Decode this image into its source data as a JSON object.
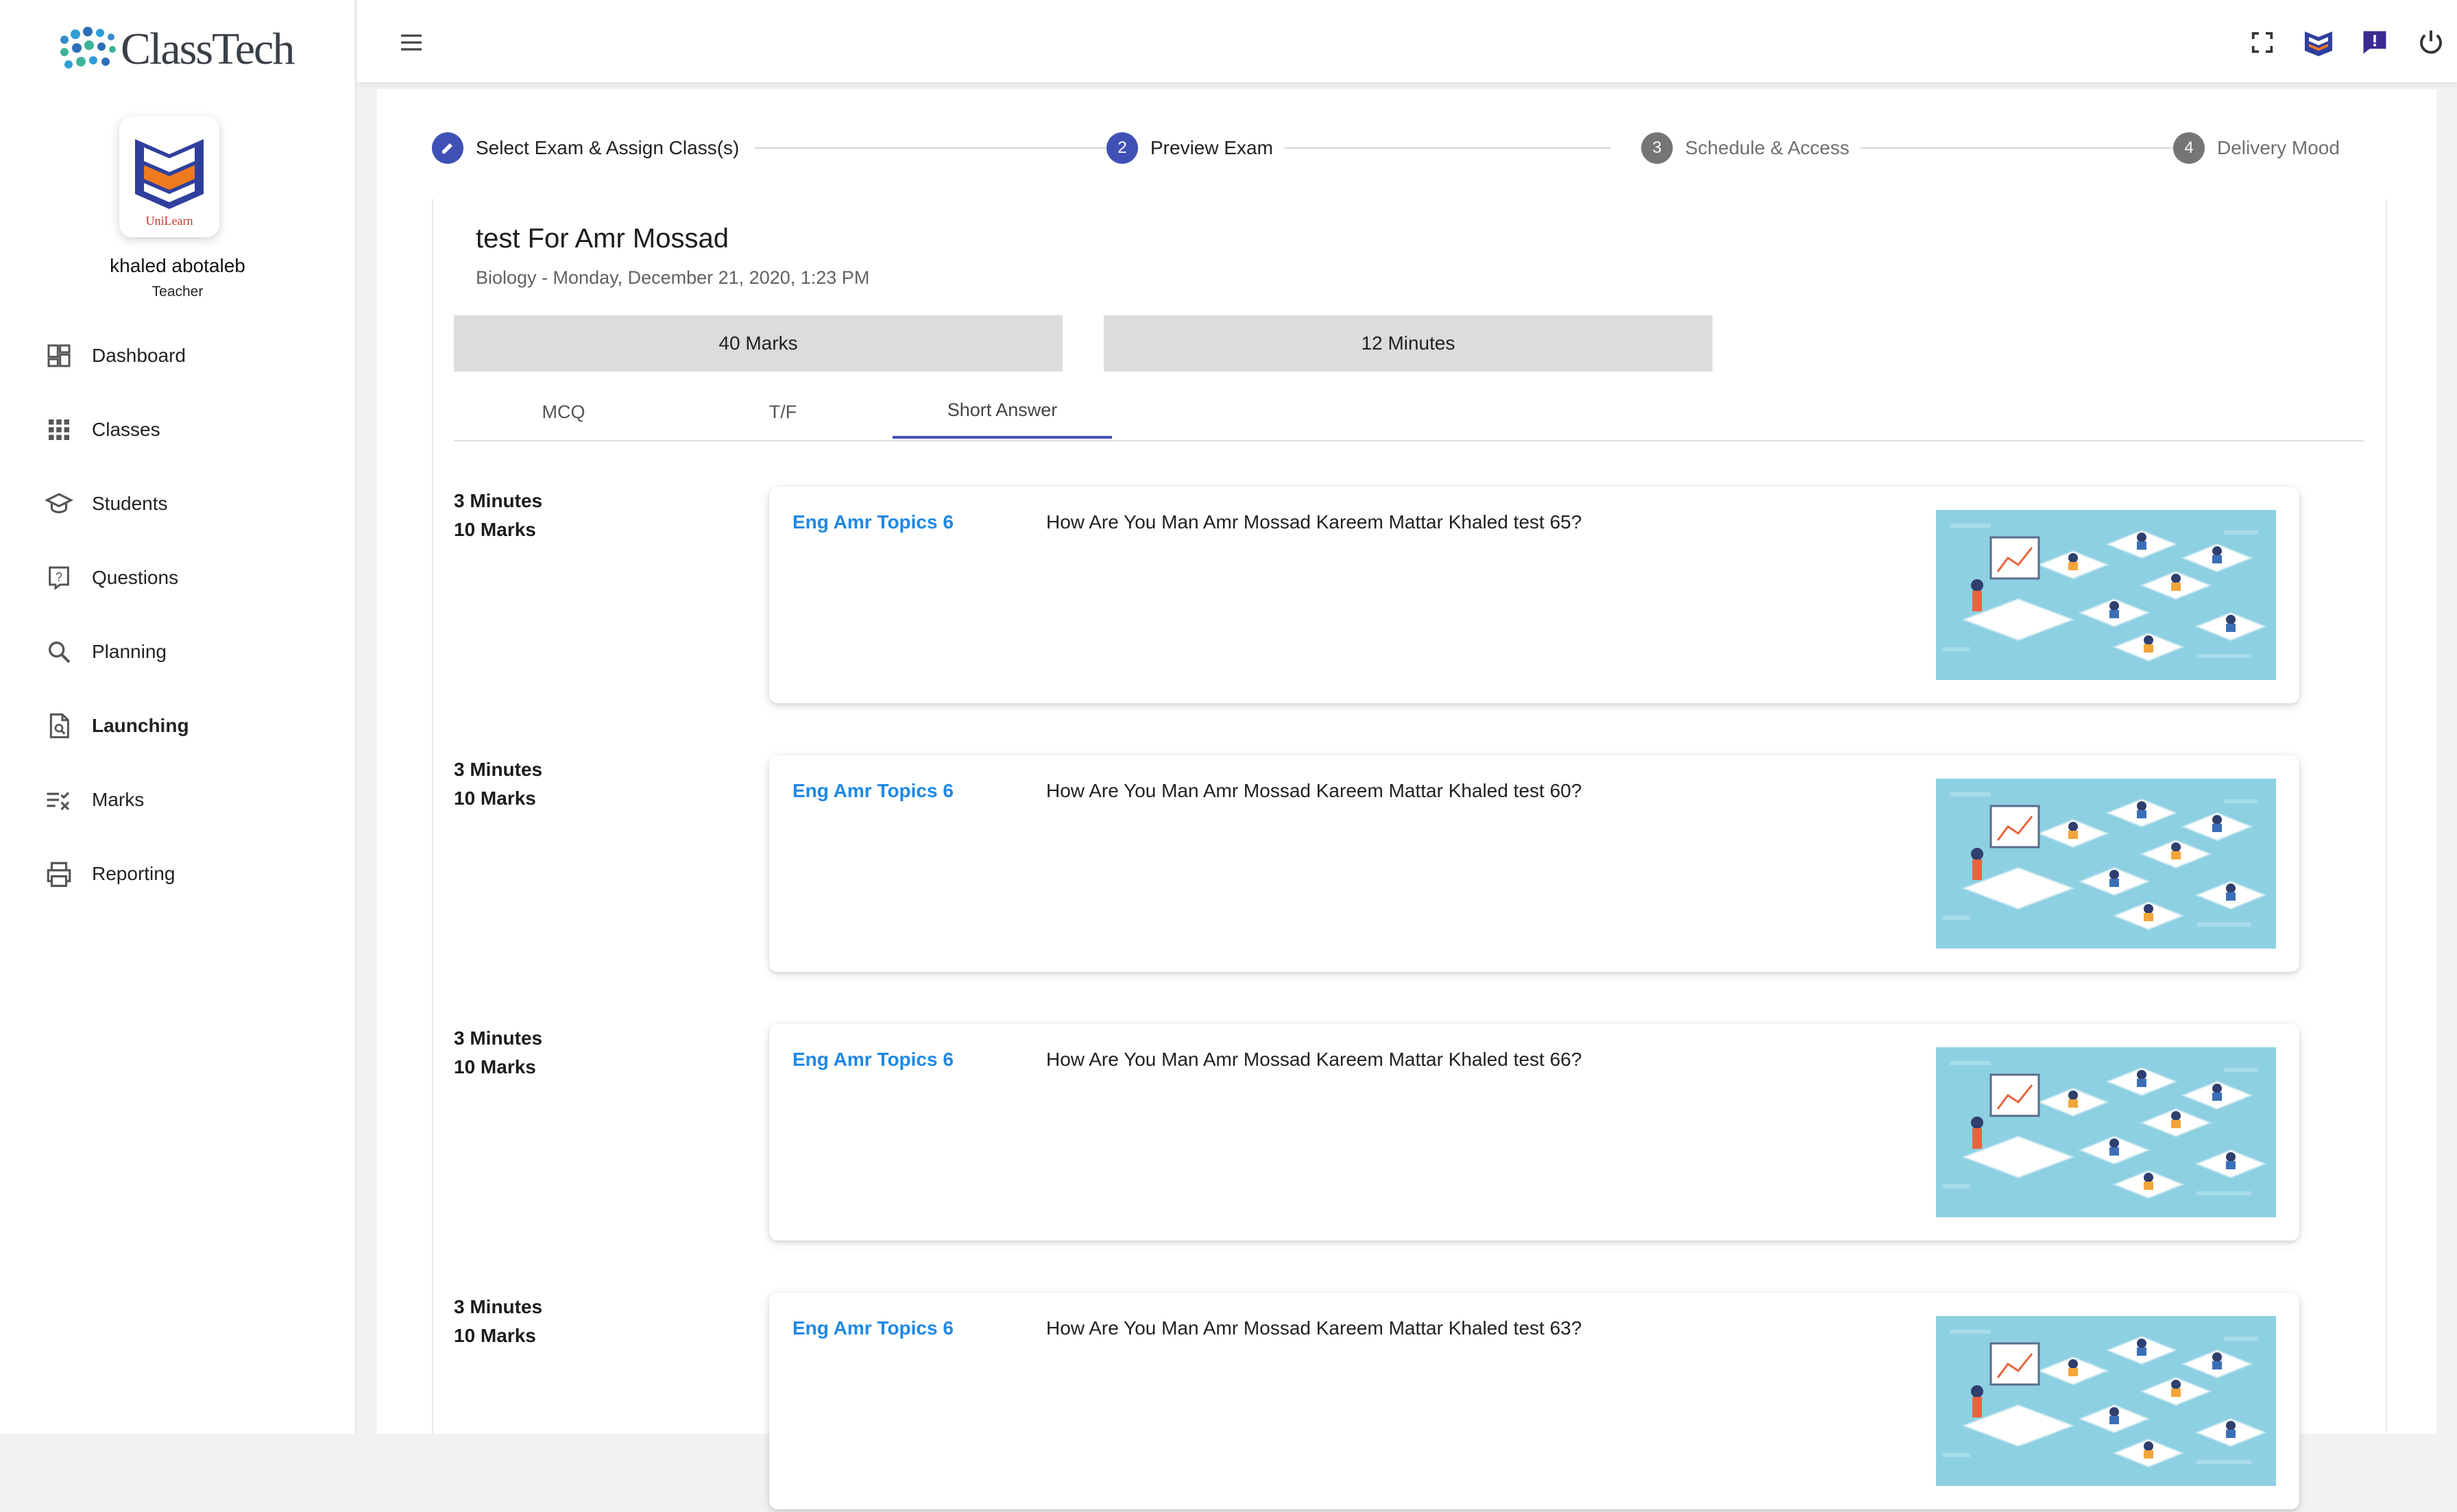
{
  "brand": {
    "name": "ClassTech"
  },
  "user": {
    "name": "khaled abotaleb",
    "role": "Teacher",
    "avatar_logo_text": "UniLearn"
  },
  "sidebar": {
    "items": [
      {
        "label": "Dashboard",
        "icon": "dashboard-icon"
      },
      {
        "label": "Classes",
        "icon": "grid-icon"
      },
      {
        "label": "Students",
        "icon": "graduation-cap-icon"
      },
      {
        "label": "Questions",
        "icon": "question-icon"
      },
      {
        "label": "Planning",
        "icon": "search-icon"
      },
      {
        "label": "Launching",
        "icon": "document-search-icon",
        "active": true
      },
      {
        "label": "Marks",
        "icon": "checklist-icon"
      },
      {
        "label": "Reporting",
        "icon": "printer-icon"
      }
    ]
  },
  "topbar": {
    "icons": [
      "menu-icon",
      "fullscreen-icon",
      "unilearn-logo-icon",
      "feedback-icon",
      "power-icon"
    ]
  },
  "stepper": {
    "steps": [
      {
        "number": "1",
        "label": "Select Exam & Assign Class(s)",
        "state": "done"
      },
      {
        "number": "2",
        "label": "Preview Exam",
        "state": "current"
      },
      {
        "number": "3",
        "label": "Schedule & Access",
        "state": "future"
      },
      {
        "number": "4",
        "label": "Delivery Mood",
        "state": "future"
      }
    ]
  },
  "exam": {
    "title": "test For Amr Mossad",
    "subtitle": "Biology - Monday, December 21, 2020, 1:23 PM",
    "marks": "40 Marks",
    "duration": "12 Minutes"
  },
  "tabs": [
    {
      "label": "MCQ"
    },
    {
      "label": "T/F"
    },
    {
      "label": "Short Answer",
      "active": true
    }
  ],
  "questions": [
    {
      "time": "3 Minutes",
      "marks": "10 Marks",
      "topic": "Eng Amr Topics 6",
      "text": "How Are You Man Amr Mossad Kareem Mattar Khaled test 65?"
    },
    {
      "time": "3 Minutes",
      "marks": "10 Marks",
      "topic": "Eng Amr Topics 6",
      "text": "How Are You Man Amr Mossad Kareem Mattar Khaled test 60?"
    },
    {
      "time": "3 Minutes",
      "marks": "10 Marks",
      "topic": "Eng Amr Topics 6",
      "text": "How Are You Man Amr Mossad Kareem Mattar Khaled test 66?"
    },
    {
      "time": "3 Minutes",
      "marks": "10 Marks",
      "topic": "Eng Amr Topics 6",
      "text": "How Are You Man Amr Mossad Kareem Mattar Khaled test 63?"
    }
  ],
  "colors": {
    "accent": "#3f51b5",
    "topic_link": "#1e88e5",
    "stat_box": "#dcdcdf"
  }
}
